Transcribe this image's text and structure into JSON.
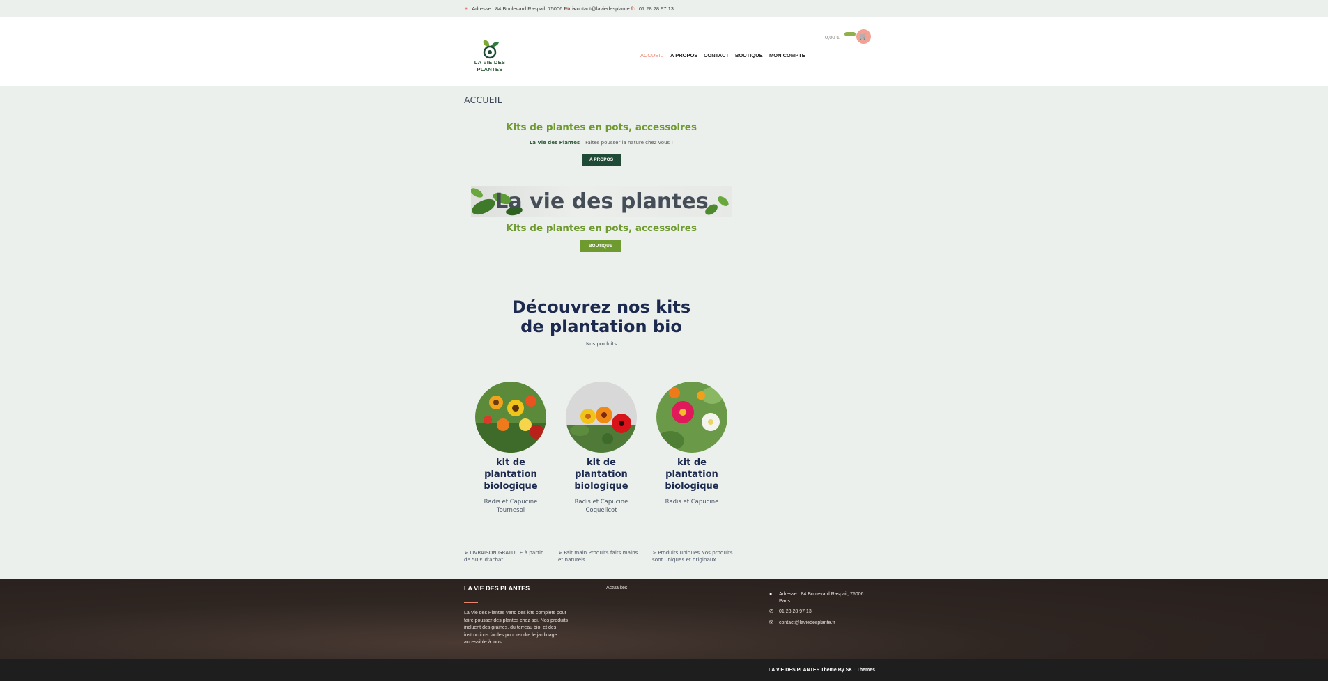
{
  "topbar": {
    "address": "Adresse : 84 Boulevard Raspail, 75006 Paris",
    "email": "contact@laviedesplante.fr",
    "phone": "01 28 28 97 13"
  },
  "header": {
    "logo_line1": "LA VIE DES",
    "logo_line2": "PLANTES",
    "nav": [
      "ACCUEIL",
      "A PROPOS",
      "CONTACT",
      "BOUTIQUE",
      "MON COMPTE"
    ],
    "cart_total": "0,00 €"
  },
  "main": {
    "page_title": "ACCUEIL",
    "hero_heading": "Kits de plantes en pots, accessoires",
    "tagline_brand": "La Vie des Plantes",
    "tagline_rest": " – Faites pousser la nature chez vous !",
    "about_button": "A PROPOS",
    "banner_text": "La vie des plantes",
    "heading2": "Kits de plantes en pots, accessoires",
    "shop_button": "BOUTIQUE",
    "big_title_line1": "Découvrez nos kits",
    "big_title_line2": "de plantation bio",
    "subtitle": "Nos produits",
    "products": [
      {
        "title": "kit de plantation biologique",
        "desc_line1": "Radis et Capucine",
        "desc_line2": "Tournesol"
      },
      {
        "title": "kit de plantation biologique",
        "desc_line1": "Radis et Capucine",
        "desc_line2": "Coquelicot"
      },
      {
        "title": "kit de plantation biologique",
        "desc_line1": "Radis et Capucine",
        "desc_line2": ""
      }
    ],
    "features": [
      "➢ LIVRAISON GRATUITE à partir de 50 € d'achat.",
      "➢ Fait main Produits faits mains et naturels.",
      "➢ Produits uniques Nos produits sont uniques et originaux."
    ]
  },
  "footer": {
    "title": "LA VIE DES PLANTES",
    "about": "La Vie des Plantes vend des kits complets pour faire pousser des plantes chez soi. Nos produits incluent des graines, du terreau bio, et des instructions faciles pour rendre le jardinage accessible à tous",
    "news": "Actualités",
    "address": "Adresse : 84 Boulevard Raspail, 75006 Paris",
    "phone": "01 28 28 97 13",
    "email": "contact@laviedesplante.fr",
    "credit": "LA VIE DES PLANTES Theme By SKT Themes"
  },
  "colors": {
    "accent": "#e9846f",
    "green": "#6e9a2f",
    "dark_green": "#1f4a36",
    "navy": "#1d2a4f"
  }
}
